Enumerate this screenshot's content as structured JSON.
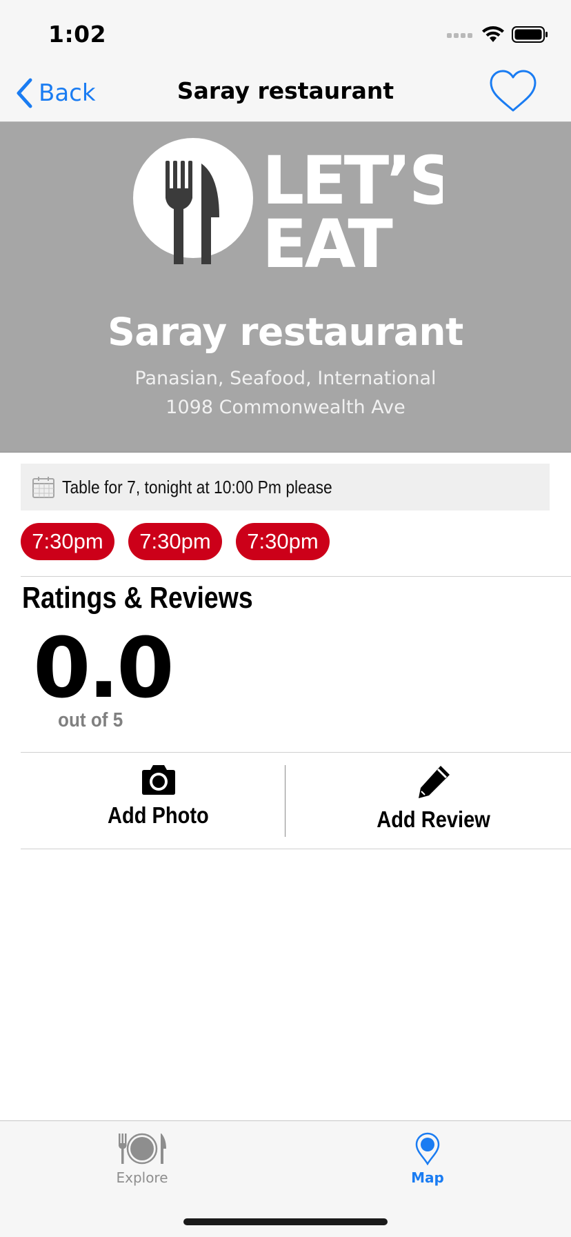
{
  "status_bar": {
    "time": "1:02"
  },
  "nav": {
    "back_label": "Back",
    "title": "Saray restaurant"
  },
  "header": {
    "logo_line1": "LET’S",
    "logo_line2": "EAT",
    "name": "Saray restaurant",
    "cuisine": "Panasian, Seafood, International",
    "address": "1098 Commonwealth Ave"
  },
  "reservation": {
    "text": "Table for 7, tonight at 10:00 Pm please",
    "time_slots": [
      "7:30pm",
      "7:30pm",
      "7:30pm"
    ]
  },
  "ratings": {
    "heading": "Ratings & Reviews",
    "value": "0.0",
    "scale": "out of 5"
  },
  "actions": {
    "add_photo": "Add Photo",
    "add_review": "Add Review"
  },
  "tab_bar": {
    "tabs": [
      {
        "label": "Explore",
        "icon": "plate-fork-knife-icon",
        "selected": false
      },
      {
        "label": "Map",
        "icon": "map-pin-icon",
        "selected": true
      }
    ]
  },
  "colors": {
    "accent": "#1a7cf2",
    "header_bg": "#a6a6a6",
    "time_slot_bg": "#cc0019",
    "logo_dark": "#3b3b3b"
  }
}
